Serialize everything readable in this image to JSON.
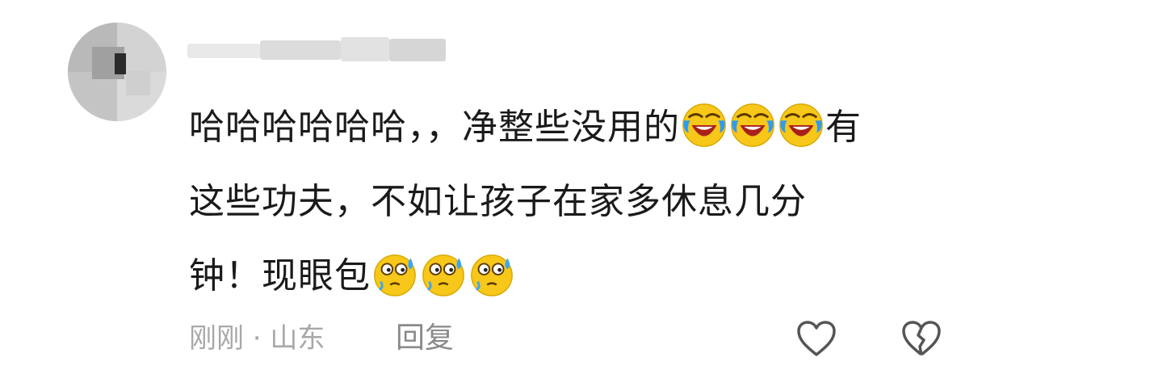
{
  "comment": {
    "line1_text": "哈哈哈哈哈哈，，净整些没用的",
    "line1_emoji_name": "laugh-cry-emoji",
    "line1_emoji_count": 3,
    "line1_tail": "有",
    "line2_text": "这些功夫，不如让孩子在家多休息几分",
    "line3_text": "钟！现眼包",
    "line3_emoji_name": "sweat-emoji",
    "line3_emoji_count": 3
  },
  "meta": {
    "time_location": "刚刚 · 山东",
    "reply_label": "回复"
  },
  "actions": {
    "like_icon": "heart-outline-icon",
    "dislike_icon": "broken-heart-outline-icon"
  },
  "colors": {
    "text": "#1a1a1a",
    "meta": "#a8a8a8",
    "reply": "#8a8a8a",
    "icon": "#555555",
    "emoji_yellow": "#f7c719"
  }
}
